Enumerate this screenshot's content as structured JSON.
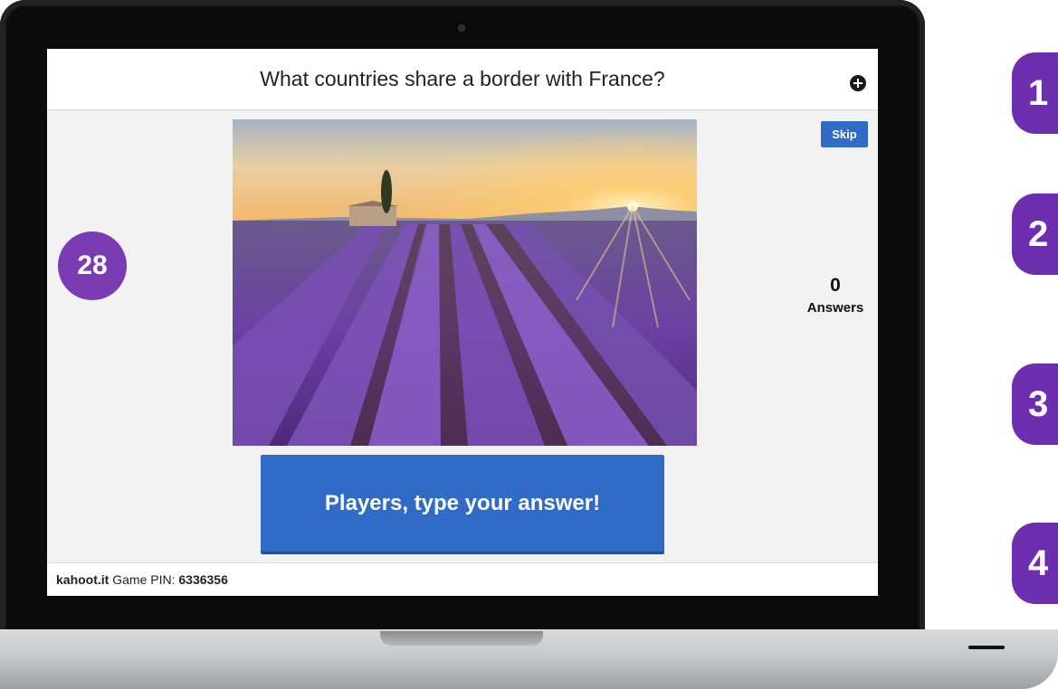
{
  "question": "What countries share a border with France?",
  "skip_label": "Skip",
  "timer": "28",
  "answers": {
    "count": "0",
    "label": "Answers"
  },
  "cta_label": "Players, type your answer!",
  "footer": {
    "site": "kahoot.it",
    "pin_label": "Game PIN:",
    "pin": "6336356"
  },
  "side_numbers": [
    "1",
    "2",
    "3",
    "4"
  ],
  "colors": {
    "purple": "#7a3bb3",
    "blue": "#2f6bc7"
  }
}
